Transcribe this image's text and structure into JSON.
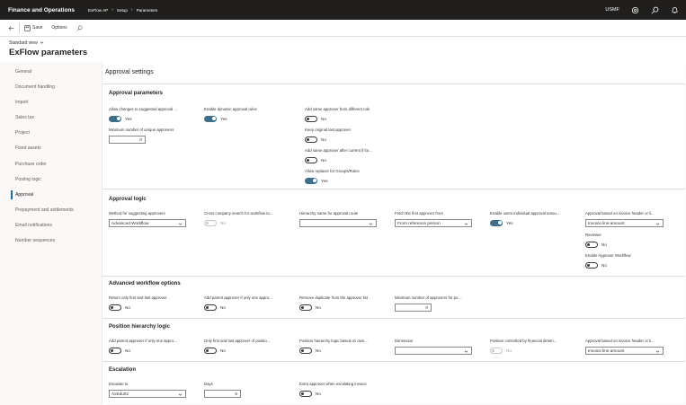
{
  "topbar": {
    "app_name": "Finance and Operations",
    "breadcrumbs": [
      "ExFlow AP",
      "Setup",
      "Parameters"
    ],
    "company": "USMF"
  },
  "actionbar": {
    "save_label": "Save",
    "options_label": "Options"
  },
  "header": {
    "view_selector": "Standard view",
    "page_title": "ExFlow parameters"
  },
  "nav": {
    "items": [
      {
        "label": "General"
      },
      {
        "label": "Document handling"
      },
      {
        "label": "Import"
      },
      {
        "label": "Sales tax"
      },
      {
        "label": "Project"
      },
      {
        "label": "Fixed assets"
      },
      {
        "label": "Purchase order"
      },
      {
        "label": "Posting logic"
      },
      {
        "label": "Approval"
      },
      {
        "label": "Prepayment and settlements"
      },
      {
        "label": "Email notifications"
      },
      {
        "label": "Number sequences"
      }
    ],
    "active_index": 8
  },
  "content": {
    "section_title": "Approval settings",
    "approval_parameters": {
      "title": "Approval parameters",
      "allow_changes": {
        "label": "Allow changes to suggested approval ...",
        "value": "Yes",
        "on": true
      },
      "dynamic_rules": {
        "label": "Enable dynamic approval rules",
        "value": "Yes",
        "on": true
      },
      "same_approver_diff_role": {
        "label": "Add same approver from different role",
        "value": "No",
        "on": false
      },
      "min_unique": {
        "label": "Minimum number of unique approvers",
        "value": "0"
      },
      "keep_original": {
        "label": "Keep original last approver",
        "value": "No",
        "on": false
      },
      "same_after_current": {
        "label": "Add same approver after current if for...",
        "value": "No",
        "on": false
      },
      "replacer_groups": {
        "label": "Allow replacer for Groups/Roles",
        "value": "Yes",
        "on": true
      }
    },
    "approval_logic": {
      "title": "Approval logic",
      "method": {
        "label": "Method for suggesting approvers",
        "value": "Advanced Workflow"
      },
      "cross_company": {
        "label": "Cross company search for workflow to...",
        "value": "No"
      },
      "hierarchy_name": {
        "label": "Hierarchy name for approval route",
        "value": ""
      },
      "fetch_first": {
        "label": "Fetch the first approver from",
        "value": "From reference person"
      },
      "individual_amount": {
        "label": "Enable users individual approval amou...",
        "value": "Yes",
        "on": true
      },
      "invoice_header": {
        "label": "Approval based on invoice header or li...",
        "value": "Invoice line amount"
      },
      "reviewer": {
        "label": "Reviewer",
        "value": "No",
        "on": false
      },
      "approver_workflow": {
        "label": "Enable Approver Workflow",
        "value": "No",
        "on": false
      }
    },
    "advanced_workflow": {
      "title": "Advanced workflow options",
      "first_last": {
        "label": "Return only first and last approver",
        "value": "No",
        "on": false
      },
      "parent_only_one": {
        "label": "Add parent approver if only one appro...",
        "value": "No",
        "on": false
      },
      "remove_duplicate": {
        "label": "Remove duplicate from the approver list",
        "value": "No",
        "on": false
      },
      "min_for_position": {
        "label": "Minimum number of approvers for po...",
        "value": "0"
      }
    },
    "position_hierarchy": {
      "title": "Position hierarchy logic",
      "parent_only_one": {
        "label": "Add parent approver if only one appro...",
        "value": "No",
        "on": false
      },
      "only_first_last": {
        "label": "Only first and last approver of positio...",
        "value": "No",
        "on": false
      },
      "logic_based_on_own": {
        "label": "Position hierarchy logic based on own...",
        "value": "No",
        "on": false
      },
      "dimension": {
        "label": "Dimension",
        "value": ""
      },
      "financial_dim": {
        "label": "Position controlled by financial dimen...",
        "value": "No"
      },
      "invoice_header": {
        "label": "Approval based on invoice header or li...",
        "value": "Invoice line amount"
      }
    },
    "escalation": {
      "title": "Escalation",
      "escalate_to": {
        "label": "Escalate to",
        "value": "AxEdu02"
      },
      "days": {
        "label": "Days",
        "value": "5"
      },
      "extra_approver": {
        "label": "Extra approver when escalating invoice",
        "value": "No",
        "on": false
      }
    }
  }
}
